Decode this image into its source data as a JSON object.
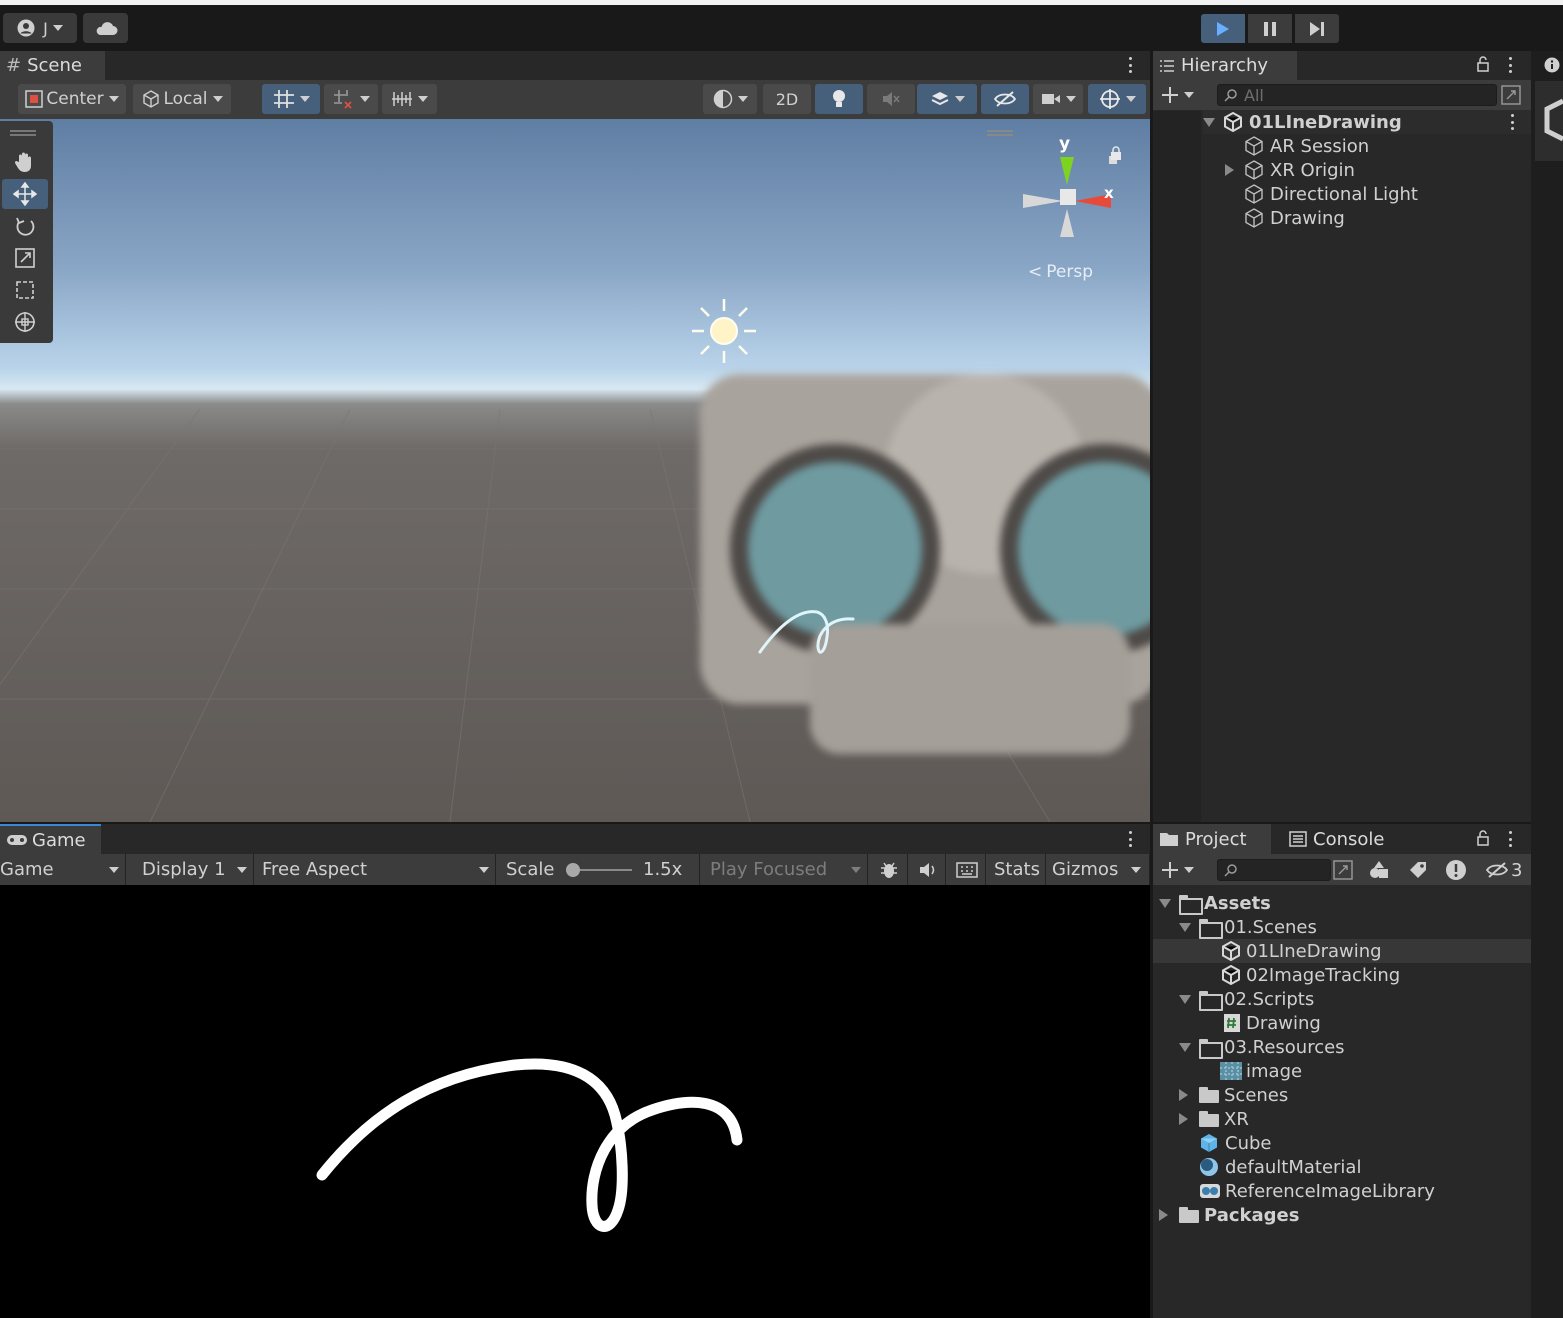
{
  "topbar": {
    "account_label": "J"
  },
  "scene": {
    "tab_label": "Scene",
    "toolbar": {
      "pivot_label": "Center",
      "space_label": "Local",
      "mode_2d_label": "2D"
    },
    "gizmo": {
      "y_label": "y",
      "x_label": "x",
      "persp_label": "Persp"
    }
  },
  "game": {
    "tab_label": "Game",
    "toolbar": {
      "view_label": "Game",
      "display_label": "Display 1",
      "aspect_label": "Free Aspect",
      "scale_label": "Scale",
      "scale_value": "1.5x",
      "play_mode_label": "Play Focused",
      "stats_label": "Stats",
      "gizmos_label": "Gizmos"
    }
  },
  "hierarchy": {
    "tab_label": "Hierarchy",
    "search_placeholder": "All",
    "scene_name": "01LIneDrawing",
    "items": [
      "AR Session",
      "XR Origin",
      "Directional Light",
      "Drawing"
    ]
  },
  "project": {
    "tabs": [
      "Project",
      "Console"
    ],
    "hidden_count": "3",
    "tree": {
      "assets": "Assets",
      "scenes_folder": "01.Scenes",
      "scene1": "01LIneDrawing",
      "scene2": "02ImageTracking",
      "scripts_folder": "02.Scripts",
      "script1": "Drawing",
      "resources_folder": "03.Resources",
      "resource1": "image",
      "scenes": "Scenes",
      "xr": "XR",
      "cube": "Cube",
      "material": "defaultMaterial",
      "library": "ReferenceImageLibrary",
      "packages": "Packages"
    }
  }
}
